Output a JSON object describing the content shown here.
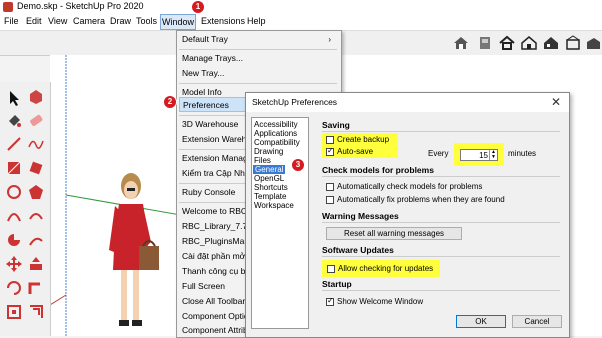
{
  "window_title": "Demo.skp - SketchUp Pro 2020",
  "menubar": {
    "items": [
      "File",
      "Edit",
      "View",
      "Camera",
      "Draw",
      "Tools",
      "Window",
      "Extensions",
      "Help"
    ]
  },
  "badges": {
    "one": "1",
    "two": "2",
    "three": "3"
  },
  "window_menu": {
    "items": [
      {
        "label": "Default Tray",
        "has_submenu": true
      },
      {
        "label": "Manage Trays..."
      },
      {
        "label": "New Tray..."
      },
      {
        "label": "Model Info"
      },
      {
        "label": "Preferences",
        "highlighted": true
      },
      {
        "label": "3D Warehouse"
      },
      {
        "label": "Extension Wareho"
      },
      {
        "label": "Extension Manage"
      },
      {
        "label": "Kiểm tra Cập Nhật"
      },
      {
        "label": "Ruby Console"
      },
      {
        "label": "Welcome to RBC C"
      },
      {
        "label": "RBC_Library_7.7.18"
      },
      {
        "label": "RBC_PluginsMana"
      },
      {
        "label": "Cài đặt phần mở r"
      },
      {
        "label": "Thanh công cụ bie"
      },
      {
        "label": "Full Screen"
      },
      {
        "label": "Close All Toolbar"
      },
      {
        "label": "Component Optio"
      },
      {
        "label": "Component Attrib"
      }
    ],
    "submenu_arrow": "›"
  },
  "preferences_dialog": {
    "title": "SketchUp Preferences",
    "close_glyph": "✕",
    "categories": [
      "Accessibility",
      "Applications",
      "Compatibility",
      "Drawing",
      "Files",
      "General",
      "OpenGL",
      "Shortcuts",
      "Template",
      "Workspace"
    ],
    "selected_category": "General",
    "saving": {
      "header": "Saving",
      "create_backup": {
        "label": "Create backup",
        "checked": false
      },
      "auto_save": {
        "label": "Auto-save",
        "checked": true
      },
      "every_label": "Every",
      "minutes_value": "15",
      "minutes_label": "minutes"
    },
    "check_models": {
      "header": "Check models for problems",
      "auto_check": {
        "label": "Automatically check models for problems",
        "checked": false
      },
      "auto_fix": {
        "label": "Automatically fix problems when they are found",
        "checked": false
      }
    },
    "warning_messages": {
      "header": "Warning Messages",
      "reset_button": "Reset all warning messages"
    },
    "software_updates": {
      "header": "Software Updates",
      "allow_updates": {
        "label": "Allow checking for updates",
        "checked": false
      }
    },
    "startup": {
      "header": "Startup",
      "show_welcome": {
        "label": "Show Welcome Window",
        "checked": true
      }
    },
    "ok_button": "OK",
    "cancel_button": "Cancel"
  },
  "colors": {
    "highlight": "#ffff3c",
    "badge": "#d71920",
    "selection": "#3779d3"
  }
}
